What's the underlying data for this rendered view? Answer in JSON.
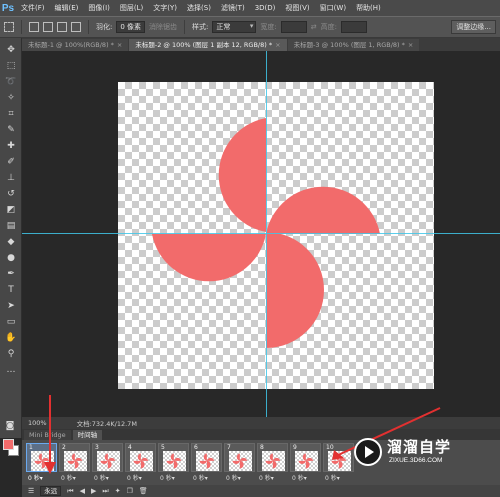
{
  "app": {
    "logo": "Ps",
    "accent": "#6fc1ff"
  },
  "menu": [
    "文件(F)",
    "编辑(E)",
    "图像(I)",
    "图层(L)",
    "文字(Y)",
    "选择(S)",
    "滤镜(T)",
    "3D(D)",
    "视图(V)",
    "窗口(W)",
    "帮助(H)"
  ],
  "options": {
    "feather_label": "羽化:",
    "feather_value": "0 像素",
    "antialias_label": "消除锯齿",
    "style_label": "样式:",
    "style_value": "正常",
    "width_label": "宽度:",
    "height_label": "高度:",
    "refine_button": "调整边缘..."
  },
  "tabs": [
    {
      "label": "未标题-1 @ 100%(RGB/8) *",
      "active": false
    },
    {
      "label": "未标题-2 @ 100% (图层 1 副本 12, RGB/8) *",
      "active": true
    },
    {
      "label": "未标题-3 @ 100% (图层 1, RGB/8) *",
      "active": false
    }
  ],
  "canvas": {
    "shape_color": "#f26b6b",
    "guide_color": "#3fc6e8"
  },
  "status": {
    "zoom": "100%",
    "doc_info": "文档:732.4K/12.7M"
  },
  "panel_tabs": {
    "mini_bridge": "Mini Bridge",
    "timeline": "时间轴"
  },
  "frames": [
    {
      "num": "1",
      "delay": "0 秒▾",
      "selected": true
    },
    {
      "num": "2",
      "delay": "0 秒▾",
      "selected": false
    },
    {
      "num": "3",
      "delay": "0 秒▾",
      "selected": false
    },
    {
      "num": "4",
      "delay": "0 秒▾",
      "selected": false
    },
    {
      "num": "5",
      "delay": "0 秒▾",
      "selected": false
    },
    {
      "num": "6",
      "delay": "0 秒▾",
      "selected": false
    },
    {
      "num": "7",
      "delay": "0 秒▾",
      "selected": false
    },
    {
      "num": "8",
      "delay": "0 秒▾",
      "selected": false
    },
    {
      "num": "9",
      "delay": "0 秒▾",
      "selected": false
    },
    {
      "num": "10",
      "delay": "0 秒▾",
      "selected": false
    }
  ],
  "controls": {
    "loop_value": "永远"
  },
  "annotation_color": "#e23030",
  "watermark": {
    "title": "溜溜自学",
    "url": "ZIXUE.3D66.COM"
  }
}
